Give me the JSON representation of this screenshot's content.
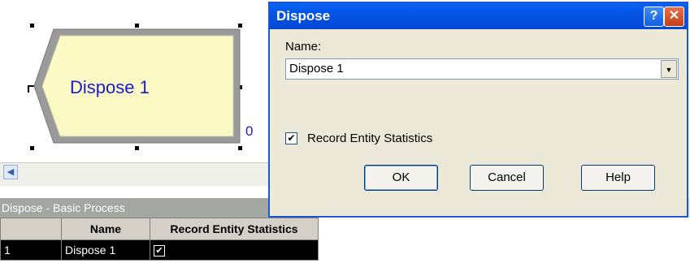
{
  "canvas": {
    "module_label": "Dispose 1",
    "module_counter": "0"
  },
  "dialog": {
    "title": "Dispose",
    "help_glyph": "?",
    "close_glyph": "✕",
    "name_label": "Name:",
    "name_value": "Dispose 1",
    "record_stats_label": "Record Entity Statistics",
    "record_stats_checked": true,
    "ok_label": "OK",
    "cancel_label": "Cancel",
    "help_label": "Help"
  },
  "spreadsheet": {
    "title": "Dispose - Basic Process",
    "columns": [
      "",
      "Name",
      "Record Entity Statistics"
    ],
    "rows": [
      {
        "index": "1",
        "name": "Dispose 1",
        "record_stats": true
      }
    ]
  },
  "icons": {
    "check_glyph": "✔",
    "combo_arrow": "▼",
    "scroll_left": "◀"
  }
}
